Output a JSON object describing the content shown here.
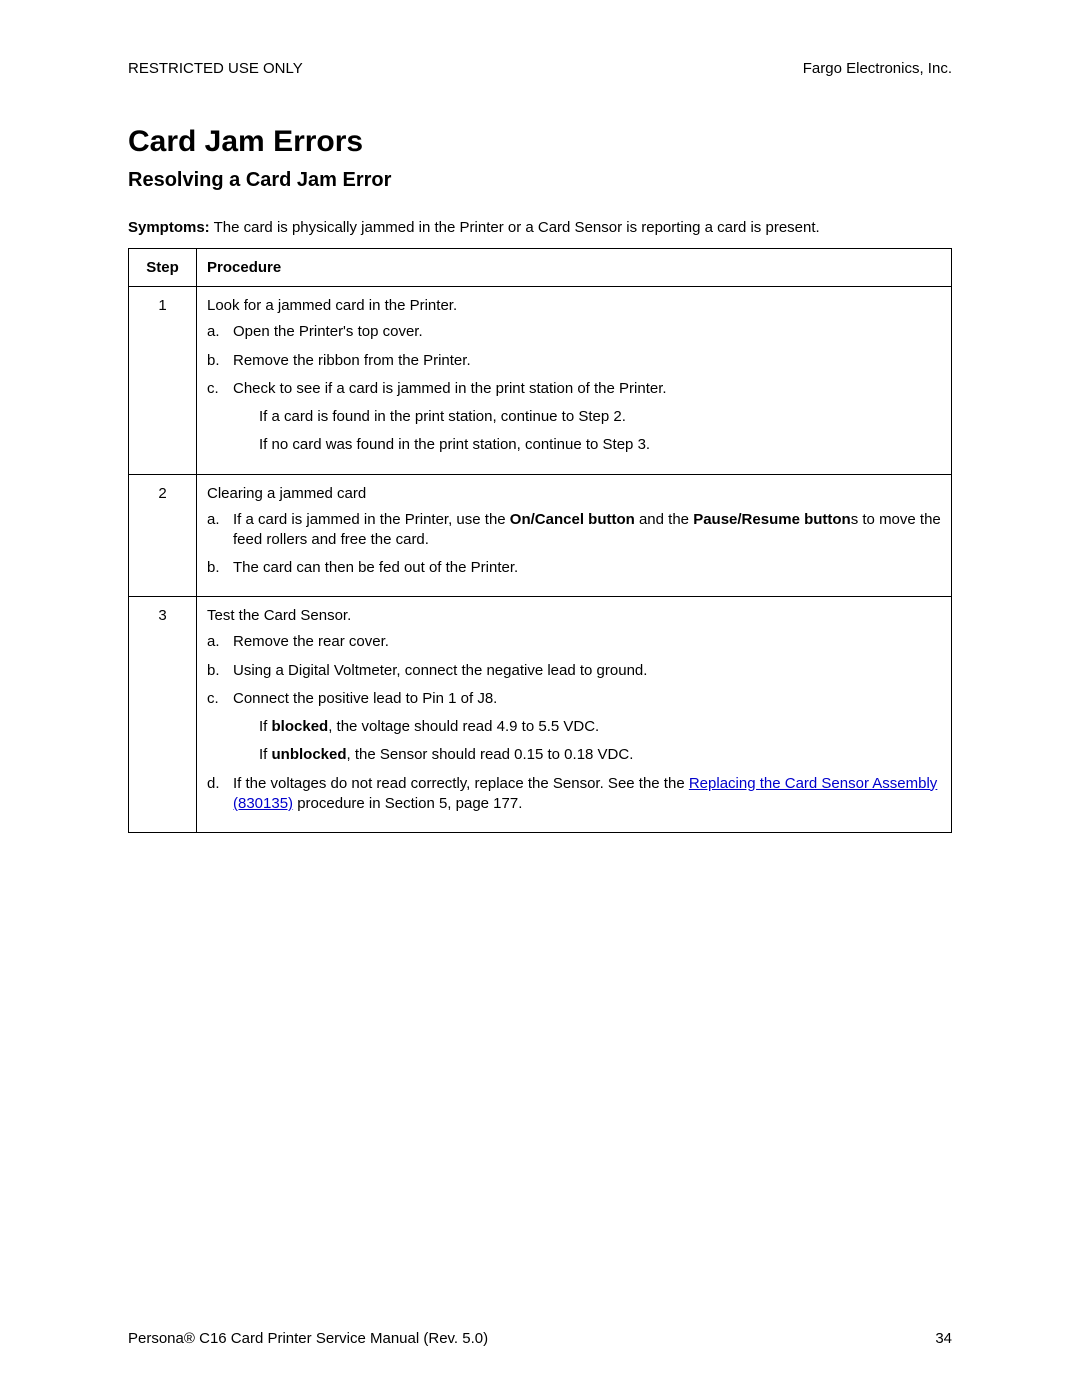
{
  "header": {
    "left": "RESTRICTED USE ONLY",
    "right": "Fargo Electronics, Inc."
  },
  "title": "Card Jam Errors",
  "subtitle": "Resolving a Card Jam Error",
  "symptoms": {
    "label": "Symptoms:",
    "text": " The card is physically jammed in the Printer or a Card Sensor is reporting a card is present."
  },
  "table": {
    "head_step": "Step",
    "head_proc": "Procedure",
    "rows": [
      {
        "step": "1",
        "intro": "Look for a jammed card in the Printer.",
        "items": [
          {
            "marker": "a.",
            "text": "Open the Printer's top cover."
          },
          {
            "marker": "b.",
            "text": "Remove the ribbon from the Printer."
          },
          {
            "marker": "c.",
            "text": "Check to see if a card is jammed in the print station of the Printer."
          }
        ],
        "notes": [
          "If a card is found in the print station, continue to Step 2.",
          "If no card was found in the print station, continue to Step 3."
        ]
      },
      {
        "step": "2",
        "intro": "Clearing a jammed card",
        "item_a": {
          "marker": "a.",
          "pre": "If a card is jammed in the Printer, use the ",
          "bold1": "On/Cancel button",
          "mid": " and the ",
          "bold2": "Pause/Resume button",
          "post": "s to move the feed rollers and free the card."
        },
        "item_b": {
          "marker": "b.",
          "text": "The card can then be fed out of the Printer."
        }
      },
      {
        "step": "3",
        "intro": "Test the Card Sensor.",
        "items": [
          {
            "marker": "a.",
            "text": "Remove the rear cover."
          },
          {
            "marker": "b.",
            "text": "Using a Digital Voltmeter, connect the negative lead to ground."
          },
          {
            "marker": "c.",
            "text": "Connect the positive lead to Pin 1 of J8."
          }
        ],
        "note_blocked": {
          "pre": "If ",
          "bold": "blocked",
          "post": ", the voltage should read 4.9 to 5.5 VDC."
        },
        "note_unblocked": {
          "pre": "If ",
          "bold": "unblocked",
          "post": ", the Sensor should read 0.15 to 0.18 VDC."
        },
        "item_d": {
          "marker": "d.",
          "pre": "If the voltages do not read correctly, replace the Sensor. See the the ",
          "link": "Replacing the Card Sensor Assembly (830135)",
          "post": " procedure in Section 5, page 177."
        }
      }
    ]
  },
  "footer": {
    "left_pre": "Persona",
    "reg": "®",
    "left_post": " C16 Card Printer Service Manual (Rev. 5.0)",
    "page": "34"
  }
}
